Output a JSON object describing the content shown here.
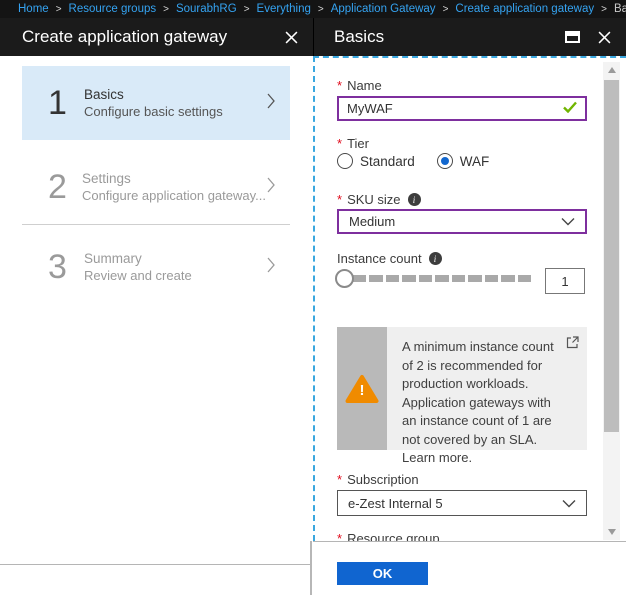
{
  "breadcrumb": {
    "separator": ">",
    "items": [
      "Home",
      "Resource groups",
      "SourabhRG",
      "Everything",
      "Application Gateway",
      "Create application gateway",
      "Basics"
    ]
  },
  "ui": {
    "required_marker": "*",
    "info_glyph": "i",
    "warning_glyph": "!"
  },
  "left_panel": {
    "title": "Create application gateway",
    "steps": [
      {
        "number": "1",
        "title": "Basics",
        "subtitle": "Configure basic settings",
        "state": "active"
      },
      {
        "number": "2",
        "title": "Settings",
        "subtitle": "Configure application gateway...",
        "state": "inactive"
      },
      {
        "number": "3",
        "title": "Summary",
        "subtitle": "Review and create",
        "state": "inactive"
      }
    ]
  },
  "right_panel": {
    "title": "Basics",
    "fields": {
      "name": {
        "label": "Name",
        "required": true,
        "value": "MyWAF",
        "valid": true
      },
      "tier": {
        "label": "Tier",
        "required": true,
        "options": [
          "Standard",
          "WAF"
        ],
        "selected": "WAF"
      },
      "sku_size": {
        "label": "SKU size",
        "required": true,
        "has_info": true,
        "value": "Medium"
      },
      "instance_count": {
        "label": "Instance count",
        "has_info": true,
        "value": "1"
      },
      "subscription": {
        "label": "Subscription",
        "required": true,
        "value": "e-Zest Internal 5"
      },
      "resource_group": {
        "label": "Resource group",
        "required": true
      }
    },
    "warning": {
      "text": "A minimum instance count of 2 is recommended for production workloads. Application gateways with an instance count of 1 are not covered by an SLA. Learn more."
    },
    "ok_button": "OK"
  },
  "colors": {
    "accent_blue": "#1065d0",
    "link_blue": "#35a3f1",
    "radio_blue": "#1267cf",
    "purple_border": "#7e2f9e",
    "valid_green": "#70b500",
    "warning_orange": "#f08b00",
    "step_highlight": "#d9eaf8",
    "focus_dashed_blue": "#3aa7df",
    "header_bg": "#1b1b1b",
    "topbar_bg": "#141414"
  }
}
